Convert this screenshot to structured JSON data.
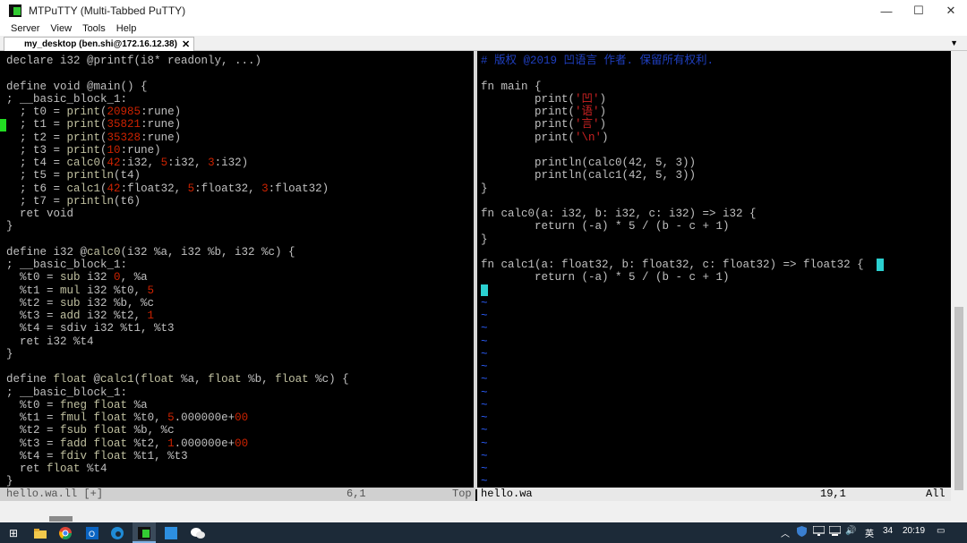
{
  "window": {
    "title": "MTPuTTY (Multi-Tabbed PuTTY)",
    "minimize_glyph": "—",
    "maximize_glyph": "☐",
    "close_glyph": "✕"
  },
  "menu": [
    "Server",
    "View",
    "Tools",
    "Help"
  ],
  "tab": {
    "label": "my_desktop (ben.shi@172.16.12.38)",
    "close_glyph": "✕",
    "dropdown_glyph": "▼"
  },
  "left_pane": {
    "lines": [
      "declare i32 @printf(i8* readonly, ...)",
      "",
      "define void @main() {",
      "; __basic_block_1:",
      "  ; t0 = print(20985:rune)",
      "  ; t1 = print(35821:rune)",
      "  ; t2 = print(35328:rune)",
      "  ; t3 = print(10:rune)",
      "  ; t4 = calc0(42:i32, 5:i32, 3:i32)",
      "  ; t5 = println(t4)",
      "  ; t6 = calc1(42:float32, 5:float32, 3:float32)",
      "  ; t7 = println(t6)",
      "  ret void",
      "}",
      "",
      "define i32 @calc0(i32 %a, i32 %b, i32 %c) {",
      "; __basic_block_1:",
      "  %t0 = sub i32 0, %a",
      "  %t1 = mul i32 %t0, 5",
      "  %t2 = sub i32 %b, %c",
      "  %t3 = add i32 %t2, 1",
      "  %t4 = sdiv i32 %t1, %t3",
      "  ret i32 %t4",
      "}",
      "",
      "define float @calc1(float %a, float %b, float %c) {",
      "; __basic_block_1:",
      "  %t0 = fneg float %a",
      "  %t1 = fmul float %t0, 5.000000e+00",
      "  %t2 = fsub float %b, %c",
      "  %t3 = fadd float %t2, 1.000000e+00",
      "  %t4 = fdiv float %t1, %t3",
      "  ret float %t4",
      "}"
    ],
    "status_file": "hello.wa.ll [+]",
    "status_pos": "6,1",
    "status_scroll": "Top"
  },
  "right_pane": {
    "lines": [
      "# 版权 @2019 凹语言 作者. 保留所有权利.",
      "",
      "fn main {",
      "        print('凹')",
      "        print('语')",
      "        print('言')",
      "        print('\\n')",
      "",
      "        println(calc0(42, 5, 3))",
      "        println(calc1(42, 5, 3))",
      "}",
      "",
      "fn calc0(a: i32, b: i32, c: i32) => i32 {",
      "        return (-a) * 5 / (b - c + 1)",
      "}",
      "",
      "fn calc1(a: float32, b: float32, c: float32) => float32 {",
      "        return (-a) * 5 / (b - c + 1)",
      "",
      "~",
      "~",
      "~",
      "~",
      "~",
      "~",
      "~",
      "~",
      "~",
      "~",
      "~",
      "~",
      "~",
      "~",
      "~"
    ],
    "status_file": "hello.wa",
    "status_pos": "19,1",
    "status_scroll": "All"
  },
  "taskbar": {
    "start_glyph": "⊞",
    "tray_chevron": "︿",
    "tray_ime": "英",
    "tray_temp": "34",
    "tray_volume": "🔊",
    "clock": "20:19",
    "notification_glyph": "▭"
  }
}
